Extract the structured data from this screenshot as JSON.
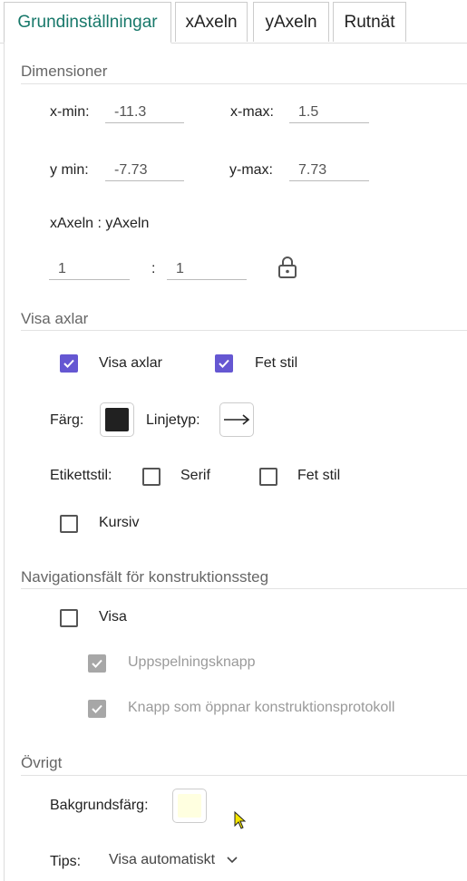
{
  "tabs": [
    {
      "label": "Grundinställningar",
      "active": true
    },
    {
      "label": "xAxeln",
      "active": false
    },
    {
      "label": "yAxeln",
      "active": false
    },
    {
      "label": "Rutnät",
      "active": false
    }
  ],
  "dimensions": {
    "section": "Dimensioner",
    "xmin_label": "x-min:",
    "xmin_value": "-11.3",
    "xmax_label": "x-max:",
    "xmax_value": "1.5",
    "ymin_label": "y min:",
    "ymin_value": "-7.73",
    "ymax_label": "y-max:",
    "ymax_value": "7.73",
    "ratio_label": "xAxeln : yAxeln",
    "ratio_x": "1",
    "ratio_sep": ":",
    "ratio_y": "1",
    "lock_icon": "lock-icon"
  },
  "axes": {
    "section": "Visa axlar",
    "show_axes_label": "Visa axlar",
    "show_axes_checked": true,
    "bold_label": "Fet stil",
    "bold_checked": true,
    "color_label": "Färg:",
    "color_value": "#212121",
    "linetype_label": "Linjetyp:",
    "linetype_icon": "arrow-right-icon",
    "labelstyle_label": "Etikettstil:",
    "serif_label": "Serif",
    "serif_checked": false,
    "labelbold_label": "Fet stil",
    "labelbold_checked": false,
    "italic_label": "Kursiv",
    "italic_checked": false
  },
  "navigation": {
    "section": "Navigationsfält för konstruktionssteg",
    "show_label": "Visa",
    "show_checked": false,
    "play_label": "Uppspelningsknapp",
    "play_checked": true,
    "protocol_label": "Knapp som öppnar konstruktionsprotokoll",
    "protocol_checked": true
  },
  "other": {
    "section": "Övrigt",
    "bgcolor_label": "Bakgrundsfärg:",
    "bgcolor_value": "#ffffe0",
    "tips_label": "Tips:",
    "tips_value": "Visa automatiskt"
  }
}
